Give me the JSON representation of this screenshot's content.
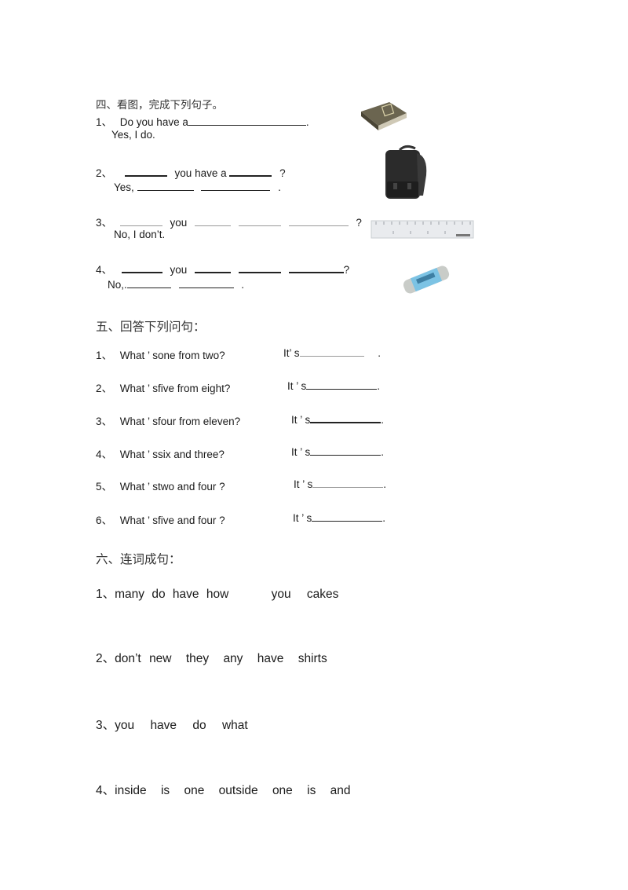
{
  "section4": {
    "title": "四、看图，完成下列句子。",
    "q1": {
      "num": "1、",
      "prefix": "Do you have a",
      "end": ".",
      "answer": "Yes, I do."
    },
    "q2": {
      "num": "2、",
      "mid": "you have a",
      "end": "?",
      "answer_prefix": "Yes,",
      "answer_end": "."
    },
    "q3": {
      "num": "3、",
      "mid": "you",
      "end": "?",
      "answer": "No, I don’t."
    },
    "q4": {
      "num": "4、",
      "mid": "you",
      "end": "?",
      "answer_prefix": "No,.",
      "answer_end": "."
    },
    "images": [
      "book-image",
      "schoolbag-image",
      "ruler-image",
      "eraser-image"
    ]
  },
  "section5": {
    "title": "五、回答下列问句：",
    "items": [
      {
        "num": "1、",
        "question": "What ’ sone from two?",
        "answer_prefix": "It’ s",
        "end": "."
      },
      {
        "num": "2、",
        "question": "What ’ sfive from eight?",
        "answer_prefix": "It ’ s",
        "end": "."
      },
      {
        "num": "3、",
        "question": "What ’ sfour from eleven?",
        "answer_prefix": "It ’ s",
        "end": "."
      },
      {
        "num": "4、",
        "question": "What ’ ssix and three?",
        "answer_prefix": "It ’ s",
        "end": "."
      },
      {
        "num": "5、",
        "question": "What ’ stwo and four ?",
        "answer_prefix": "It ’ s",
        "end": "."
      },
      {
        "num": "6、",
        "question": "What ’ sfive and four ?",
        "answer_prefix": "It ’ s",
        "end": "."
      }
    ]
  },
  "section6": {
    "title": "六、连词成句：",
    "items": [
      {
        "num": "1、",
        "words": [
          "many",
          "do",
          "have",
          "how",
          "you",
          "cakes"
        ]
      },
      {
        "num": "2、",
        "words": [
          "don’t",
          "new",
          "they",
          "any",
          "have",
          "shirts"
        ]
      },
      {
        "num": "3、",
        "words": [
          "you",
          "have",
          "do",
          "what"
        ]
      },
      {
        "num": "4、",
        "words": [
          "inside",
          "is",
          "one",
          "outside",
          "one",
          "is",
          "and"
        ]
      }
    ]
  }
}
